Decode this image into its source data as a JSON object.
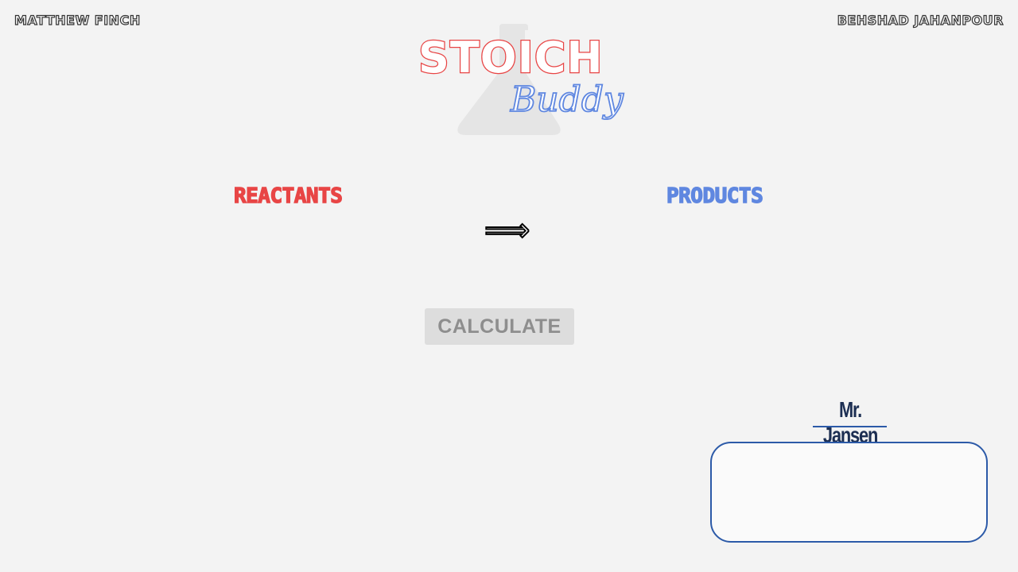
{
  "header": {
    "author_left": "MATTHEW FINCH",
    "author_right": "BEHSHAD JAHANPOUR"
  },
  "logo": {
    "word1": "STOICH",
    "word2": "Buddy",
    "icon": "flask-icon"
  },
  "equation": {
    "reactants_label": "REACTANTS",
    "products_label": "PRODUCTS",
    "arrow": "⟹"
  },
  "actions": {
    "calculate_label": "CALCULATE"
  },
  "assistant": {
    "name": "Mr. Jansen",
    "message": ""
  },
  "colors": {
    "reactant_red": "#e84545",
    "product_blue": "#5f87e0",
    "teacher_navy": "#1c2e52",
    "box_border": "#2c5aa8",
    "background": "#f3f3f3",
    "button_bg": "#dddddd",
    "button_text": "#8e8e8e"
  }
}
